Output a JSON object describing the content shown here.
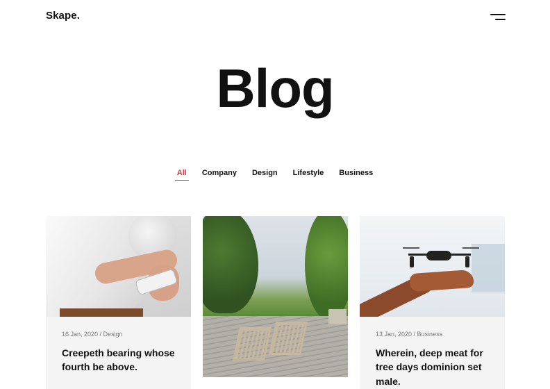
{
  "brand": {
    "logo": "Skape."
  },
  "page": {
    "title": "Blog"
  },
  "filters": [
    {
      "label": "All",
      "active": true
    },
    {
      "label": "Company",
      "active": false
    },
    {
      "label": "Design",
      "active": false
    },
    {
      "label": "Lifestyle",
      "active": false
    },
    {
      "label": "Business",
      "active": false
    }
  ],
  "posts": [
    {
      "meta": "16 Jan, 2020 / Design",
      "title": "Creepeth bearing whose fourth be above.",
      "image": "person-holding-phone"
    },
    {
      "meta": "",
      "title": "",
      "image": "wooden-deck-chairs-garden"
    },
    {
      "meta": "13 Jan, 2020 / Business",
      "title": "Wherein, deep meat for tree days dominion set male.",
      "image": "drone-over-hand"
    }
  ],
  "colors": {
    "accent": "#d9363e",
    "text": "#111111",
    "card_bg": "#f4f4f4"
  },
  "icons": {
    "menu": "menu-icon"
  }
}
